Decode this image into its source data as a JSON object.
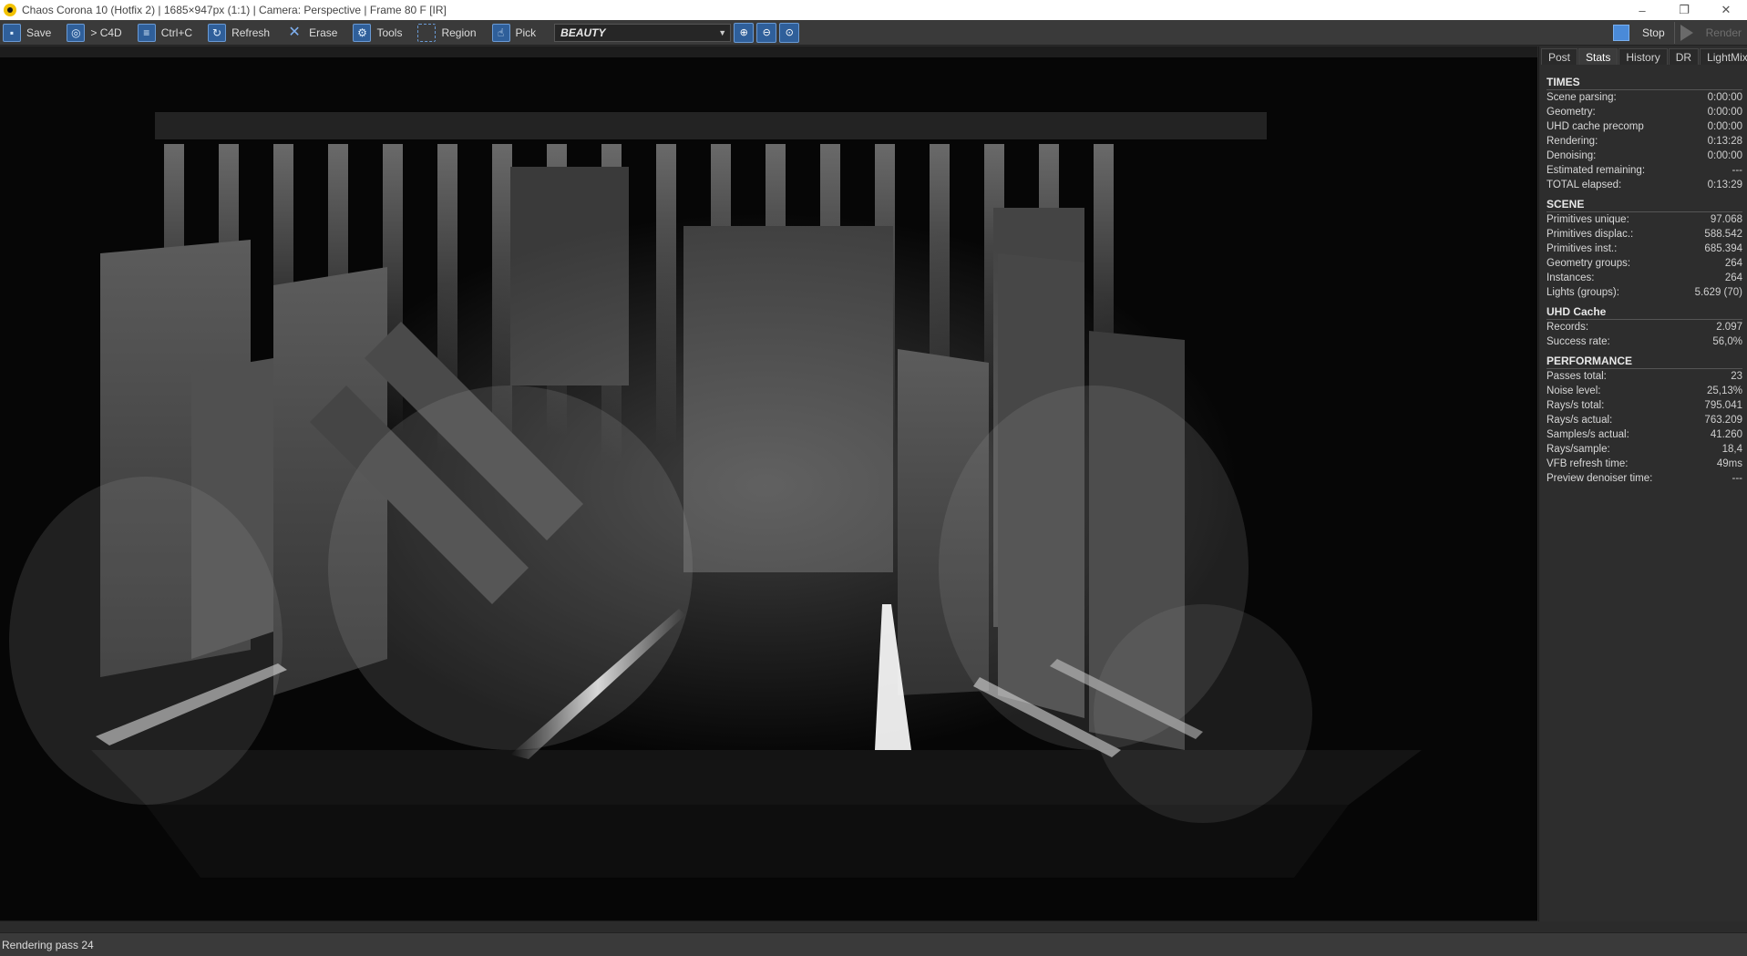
{
  "window": {
    "title": "Chaos Corona 10 (Hotfix 2) | 1685×947px (1:1) | Camera: Perspective | Frame 80 F [IR]",
    "controls": [
      "–",
      "❐",
      "✕"
    ]
  },
  "toolbar": {
    "save_label": "Save",
    "c4d_label": "> C4D",
    "copy_label": "Ctrl+C",
    "refresh_label": "Refresh",
    "erase_label": "Erase",
    "tools_label": "Tools",
    "region_label": "Region",
    "pick_label": "Pick",
    "pass_selected": "BEAUTY",
    "stop_label": "Stop",
    "render_label": "Render"
  },
  "tabs": [
    "Post",
    "Stats",
    "History",
    "DR",
    "LightMix"
  ],
  "active_tab": "Stats",
  "stats": {
    "times": {
      "title": "TIMES",
      "rows": [
        {
          "label": "Scene parsing:",
          "value": "0:00:00"
        },
        {
          "label": "Geometry:",
          "value": "0:00:00"
        },
        {
          "label": "UHD cache precomp",
          "value": "0:00:00"
        },
        {
          "label": "Rendering:",
          "value": "0:13:28"
        },
        {
          "label": "Denoising:",
          "value": "0:00:00"
        },
        {
          "label": "Estimated remaining:",
          "value": "---"
        },
        {
          "label": "TOTAL elapsed:",
          "value": "0:13:29"
        }
      ]
    },
    "scene": {
      "title": "SCENE",
      "rows": [
        {
          "label": "Primitives unique:",
          "value": "97.068"
        },
        {
          "label": "Primitives displac.:",
          "value": "588.542"
        },
        {
          "label": "Primitives inst.:",
          "value": "685.394"
        },
        {
          "label": "Geometry groups:",
          "value": "264"
        },
        {
          "label": "Instances:",
          "value": "264"
        },
        {
          "label": "Lights (groups):",
          "value": "5.629 (70)"
        }
      ]
    },
    "uhd": {
      "title": "UHD Cache",
      "rows": [
        {
          "label": "Records:",
          "value": "2.097"
        },
        {
          "label": "Success rate:",
          "value": "56,0%"
        }
      ]
    },
    "performance": {
      "title": "PERFORMANCE",
      "rows": [
        {
          "label": "Passes total:",
          "value": "23"
        },
        {
          "label": "Noise level:",
          "value": "25,13%"
        },
        {
          "label": "Rays/s total:",
          "value": "795.041"
        },
        {
          "label": "Rays/s actual:",
          "value": "763.209"
        },
        {
          "label": "Samples/s actual:",
          "value": "41.260"
        },
        {
          "label": "Rays/sample:",
          "value": "18,4"
        },
        {
          "label": "VFB refresh time:",
          "value": "49ms"
        },
        {
          "label": "Preview denoiser time:",
          "value": "---"
        }
      ]
    }
  },
  "status": {
    "text": "Rendering pass 24"
  },
  "icons": {
    "save": "save-icon",
    "c4d": "c4d-icon",
    "copy": "copy-icon",
    "refresh": "refresh-icon",
    "erase": "erase-icon",
    "tools": "gear-icon",
    "region": "region-icon",
    "pick": "pick-icon",
    "zoom_in": "zoom-in-icon",
    "zoom_out": "zoom-out-icon",
    "zoom_fit": "zoom-fit-icon"
  },
  "colors": {
    "accent": "#4a8ad8",
    "panel_bg": "#2d2d2d",
    "toolbar_bg": "#3a3a3a"
  }
}
